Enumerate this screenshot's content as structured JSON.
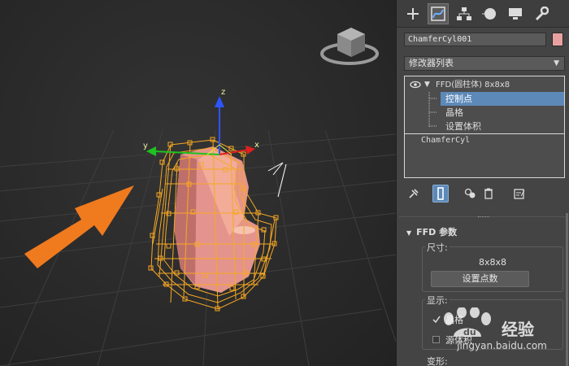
{
  "viewport": {
    "gizmo_z_label": "z",
    "gizmo_y_label": "y",
    "gizmo_x_label": "x",
    "arrow_color": "#f07a1e",
    "lattice_color": "#f7a823",
    "object_color": "#e4948c"
  },
  "panel": {
    "tabs": [
      {
        "icon": "create-plus-icon"
      },
      {
        "icon": "modify-curve-icon",
        "active": true
      },
      {
        "icon": "hierarchy-icon"
      },
      {
        "icon": "motion-circle-icon"
      },
      {
        "icon": "display-monitor-icon"
      },
      {
        "icon": "utilities-wrench-icon"
      }
    ],
    "object_name": "ChamferCyl001",
    "object_color": "#e8a0a0",
    "modifier_list_label": "修改器列表",
    "stack": {
      "modifier_name": "FFD(圆柱体) 8x8x8",
      "sub_items": [
        "控制点",
        "晶格",
        "设置体积"
      ],
      "selected_sub_item": "控制点",
      "base_object": "ChamferCyl"
    },
    "rollout": {
      "title": "FFD 参数",
      "dimensions_label": "尺寸:",
      "dimensions_value": "8x8x8",
      "set_points_button": "设置点数",
      "display_label": "显示:",
      "lattice_checkbox_label": "晶格",
      "lattice_checked": true,
      "source_volume_label": "源体积",
      "source_volume_checked": false,
      "deform_label": "变形:"
    }
  },
  "watermark": {
    "text": "经验",
    "url": "jingyan.baidu.com"
  }
}
